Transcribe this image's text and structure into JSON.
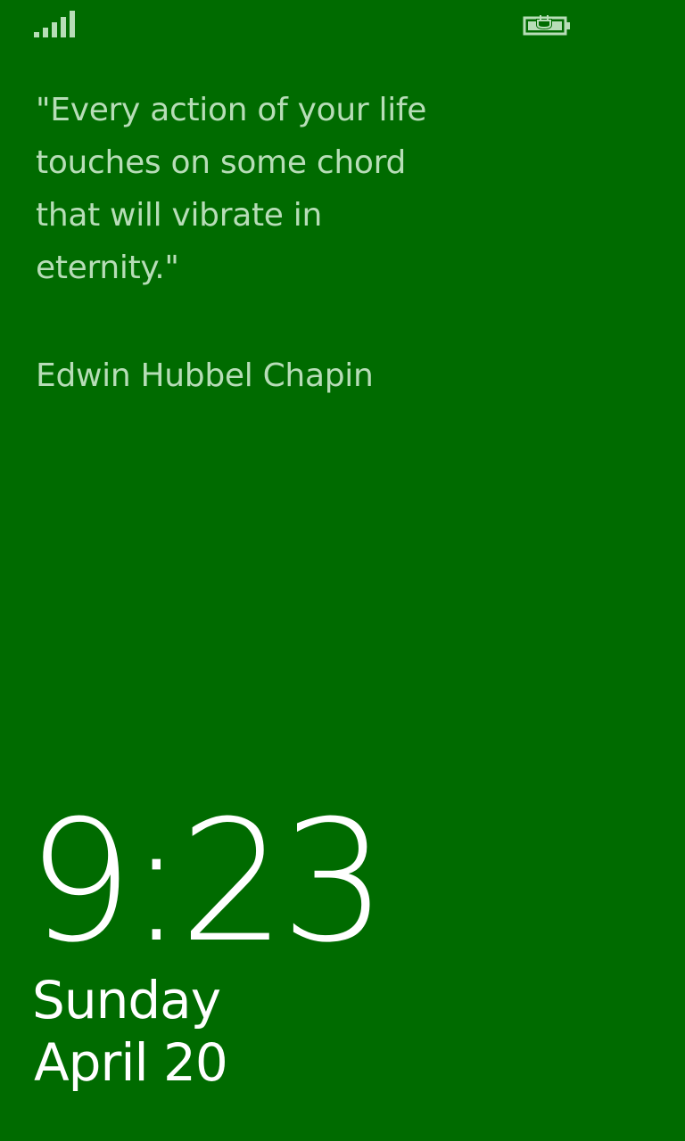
{
  "theme": {
    "background": "#006b00",
    "quote_color": "#b7ddb7",
    "clock_color": "#ffffff"
  },
  "status_bar": {
    "signal_icon": "signal-strength-icon",
    "battery_icon": "battery-charging-icon",
    "signal_level": "5 of 5 bars"
  },
  "quote": {
    "text": "\"Every action of your life\ntouches on some chord\nthat will vibrate in\neternity.\"",
    "author": "Edwin Hubbel Chapin"
  },
  "clock": {
    "time": "9:23",
    "day": "Sunday",
    "date": "April 20"
  }
}
